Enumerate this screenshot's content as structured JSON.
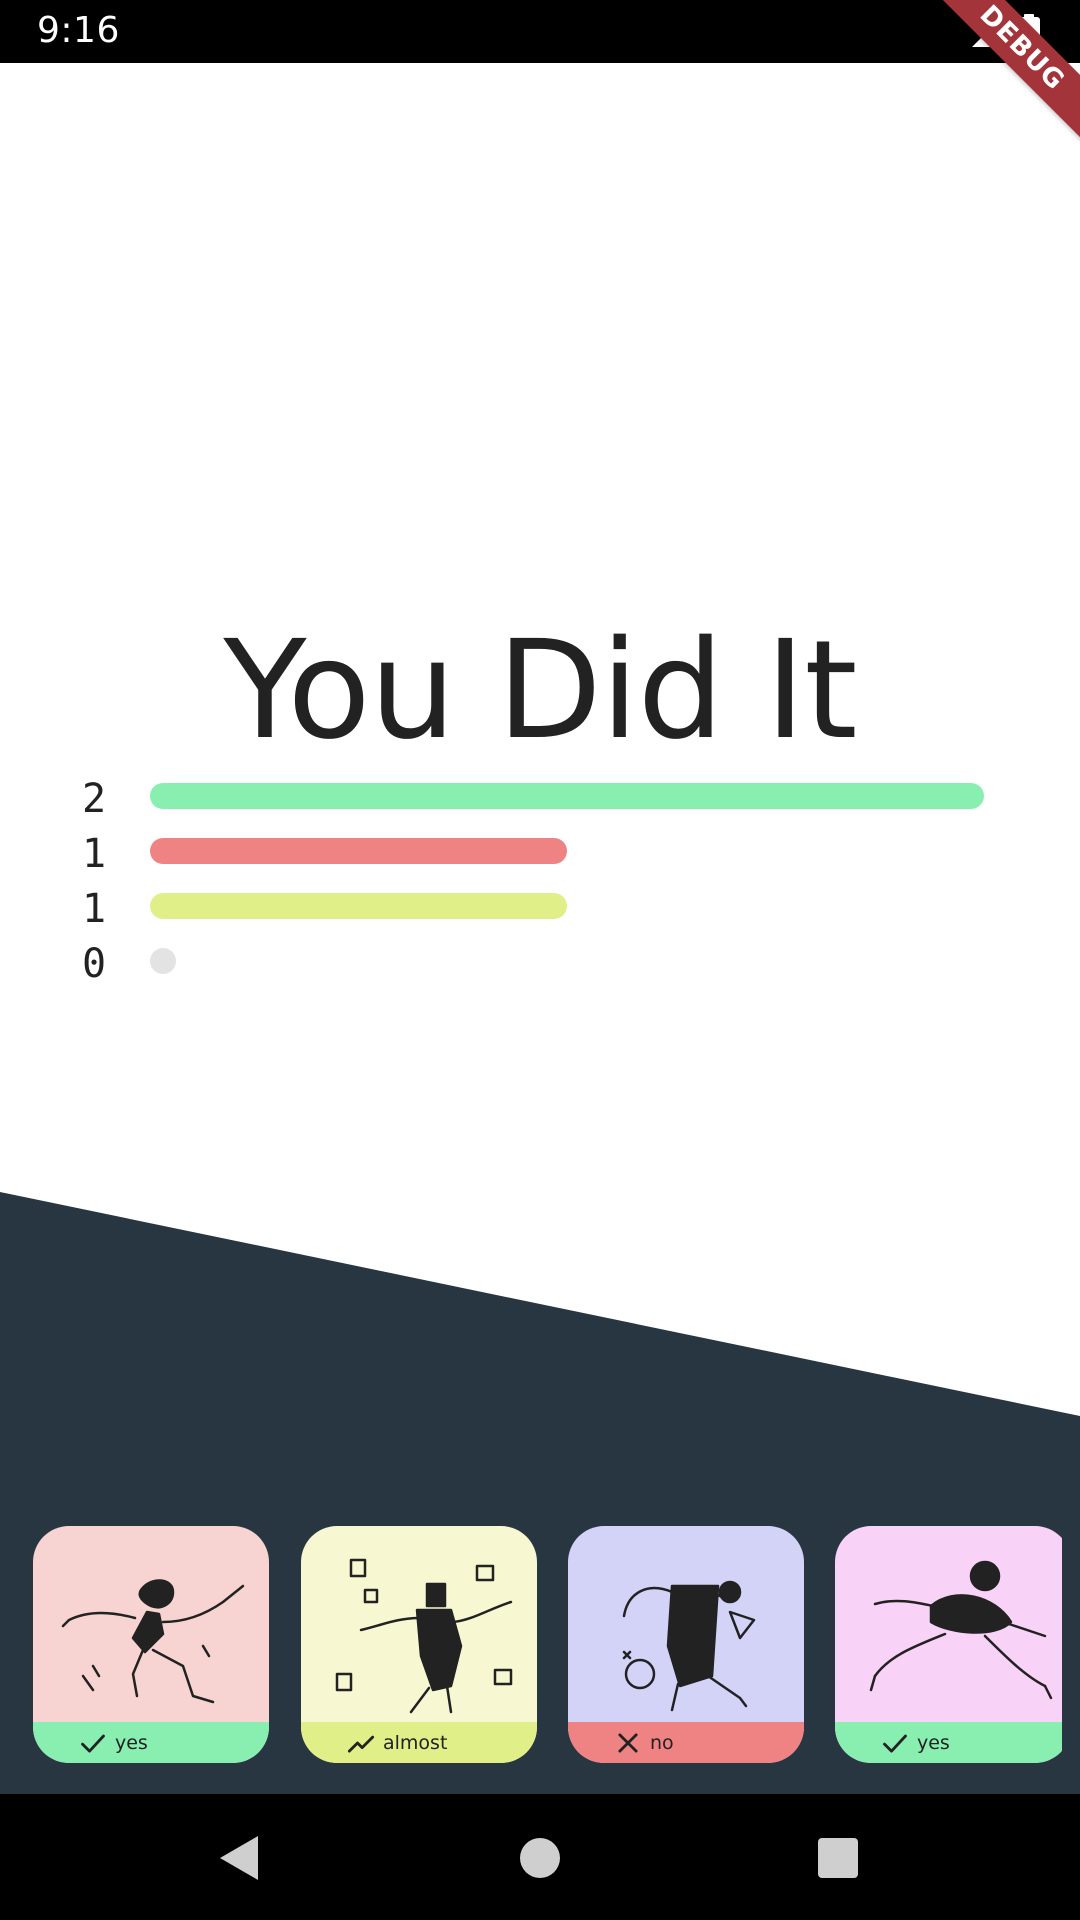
{
  "status_bar": {
    "time": "9:16",
    "icons": [
      "signal-icon",
      "battery-icon"
    ]
  },
  "debug_banner": "DEBUG",
  "title": "You Did It",
  "stats": [
    {
      "count": "2",
      "value": 2,
      "color": "#88efb1"
    },
    {
      "count": "1",
      "value": 1,
      "color": "#ef8383"
    },
    {
      "count": "1",
      "value": 1,
      "color": "#e1ef88"
    },
    {
      "count": "0",
      "value": 0,
      "color": "#e3e3e3"
    }
  ],
  "stats_max": 2,
  "colors": {
    "dark_section": "#283641",
    "title_text": "#222222"
  },
  "cards": [
    {
      "label": "yes",
      "icon": "check-icon",
      "bg": "#f7d4d2",
      "footer": "#88efb1",
      "art": "dancer-illustration"
    },
    {
      "label": "almost",
      "icon": "trend-up-icon",
      "bg": "#f7f8d2",
      "footer": "#e1ef88",
      "art": "juggler-illustration"
    },
    {
      "label": "no",
      "icon": "close-icon",
      "bg": "#d3d3f8",
      "footer": "#ef8383",
      "art": "kicker-illustration"
    },
    {
      "label": "yes",
      "icon": "check-icon",
      "bg": "#f8d3f7",
      "footer": "#88efb1",
      "art": "runner-illustration"
    }
  ],
  "nav": [
    "back-icon",
    "home-icon",
    "recents-icon"
  ]
}
